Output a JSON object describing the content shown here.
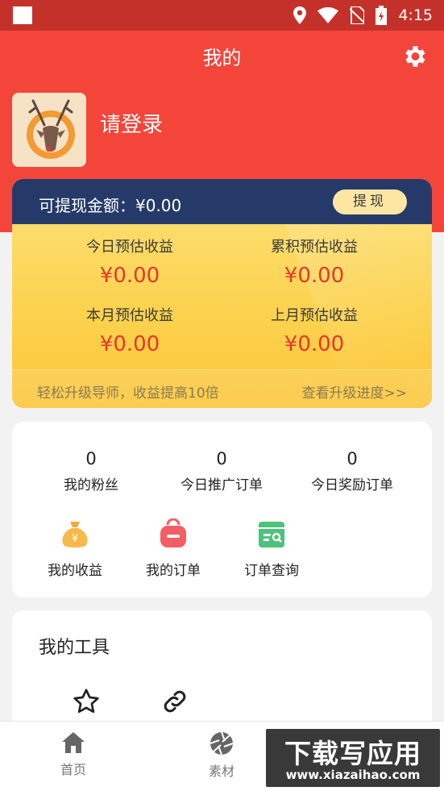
{
  "status_bar": {
    "time": "4:15"
  },
  "header": {
    "title": "我的"
  },
  "profile": {
    "login_text": "请登录"
  },
  "earnings": {
    "withdraw_label": "可提现金额：¥0.00",
    "withdraw_button": "提现",
    "stats": [
      {
        "label": "今日预估收益",
        "value": "¥0.00"
      },
      {
        "label": "累积预估收益",
        "value": "¥0.00"
      },
      {
        "label": "本月预估收益",
        "value": "¥0.00"
      },
      {
        "label": "上月预估收益",
        "value": "¥0.00"
      }
    ],
    "footer_left": "轻松升级导师，收益提高10倍",
    "footer_right": "查看升级进度>>"
  },
  "counters": [
    {
      "value": "0",
      "label": "我的粉丝"
    },
    {
      "value": "0",
      "label": "今日推广订单"
    },
    {
      "value": "0",
      "label": "今日奖励订单"
    }
  ],
  "quick_links": [
    {
      "label": "我的收益",
      "icon": "money-bag-icon"
    },
    {
      "label": "我的订单",
      "icon": "order-icon"
    },
    {
      "label": "订单查询",
      "icon": "order-search-icon"
    }
  ],
  "tools": {
    "title": "我的工具",
    "items": [
      {
        "icon": "star-icon"
      },
      {
        "icon": "link-icon"
      }
    ]
  },
  "bottom_nav": [
    {
      "label": "首页",
      "icon": "home-icon"
    },
    {
      "label": "素材",
      "icon": "aperture-icon"
    }
  ],
  "watermark": {
    "title": "下载写应用",
    "url": "www.xiazaihao.com"
  },
  "colors": {
    "header_red": "#f4453b",
    "status_red": "#c4312a",
    "card_navy": "#263a69",
    "value_red": "#e8372c",
    "card_yellow": "#fcd24d"
  }
}
